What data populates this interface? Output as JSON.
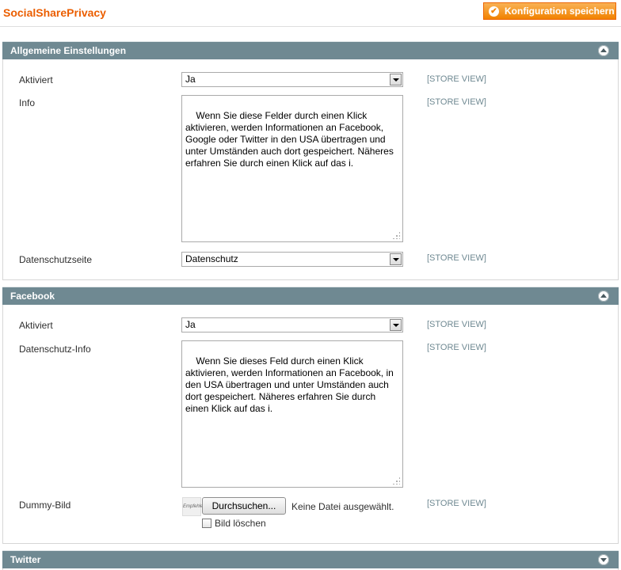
{
  "page": {
    "title": "SocialSharePrivacy",
    "save_label": "Konfiguration speichern"
  },
  "sections": {
    "general": {
      "title": "Allgemeine Einstellungen",
      "active_label": "Aktiviert",
      "active_value": "Ja",
      "info_label": "Info",
      "info_value": "Wenn Sie diese Felder durch einen Klick aktivieren, werden Informationen an Facebook, Google oder Twitter in den USA übertragen und unter Umständen auch dort gespeichert. Näheres erfahren Sie durch einen Klick auf das i.",
      "privacy_page_label": "Datenschutzseite",
      "privacy_page_value": "Datenschutz"
    },
    "facebook": {
      "title": "Facebook",
      "active_label": "Aktiviert",
      "active_value": "Ja",
      "privacy_info_label": "Datenschutz-Info",
      "privacy_info_value": "Wenn Sie dieses Feld durch einen Klick aktivieren, werden Informationen an Facebook, in den USA übertragen und unter Umständen auch dort gespeichert. Näheres erfahren Sie durch einen Klick auf das i.",
      "dummy_image_label": "Dummy-Bild",
      "thumb_text": "Empfehlen",
      "browse_label": "Durchsuchen...",
      "no_file_label": "Keine Datei ausgewählt.",
      "delete_image_label": "Bild löschen",
      "delete_image_checked": false
    },
    "twitter": {
      "title": "Twitter"
    }
  },
  "scope_label": "[STORE VIEW]",
  "icons": {
    "save": "check-circle-icon",
    "collapse": "collapse-up-icon",
    "expand": "expand-down-icon"
  },
  "colors": {
    "accent": "#eb5e00",
    "section_header": "#6f8992",
    "button": "#f18200"
  }
}
